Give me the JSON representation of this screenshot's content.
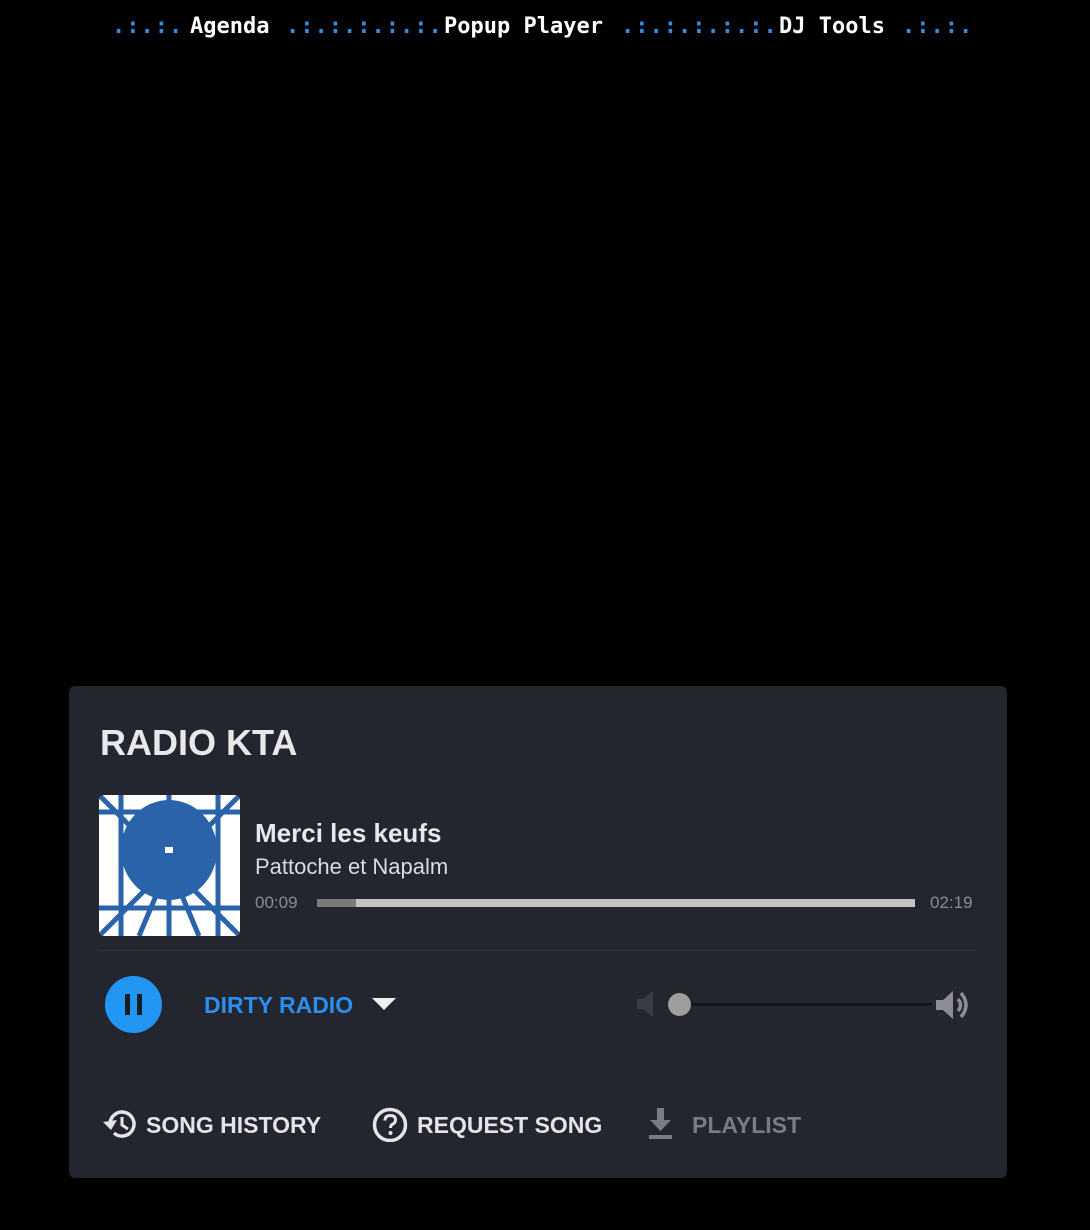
{
  "nav": {
    "dots_left": ".:.:.",
    "dots_mid1": ".:.:.:.:.:.",
    "dots_mid2": ".:.:.:.:.:.",
    "dots_right": ".:.:.",
    "agenda": "Agenda",
    "popup_player": "Popup Player",
    "dj_tools": "DJ Tools",
    "dot_color": "#2f8de4"
  },
  "player": {
    "station": "RADIO KTA",
    "song_title": "Merci les keufs",
    "song_artist": "Pattoche et Napalm",
    "elapsed": "00:09",
    "duration": "02:19",
    "progress_fraction": 0.065,
    "channel": "DIRTY RADIO",
    "volume_fraction": 0.0,
    "state": "playing",
    "accent": "#2196f3",
    "card_bg": "#23252f"
  },
  "actions": {
    "history_label": "SONG HISTORY",
    "history_icon": "history-icon",
    "request_label": "REQUEST SONG",
    "request_icon": "help-circle-icon",
    "playlist_label": "PLAYLIST",
    "playlist_icon": "download-icon"
  },
  "icons": {
    "play_state": "pause-icon",
    "volume_low": "volume-mute-icon",
    "volume_high": "volume-up-icon",
    "dropdown": "caret-down-icon"
  }
}
